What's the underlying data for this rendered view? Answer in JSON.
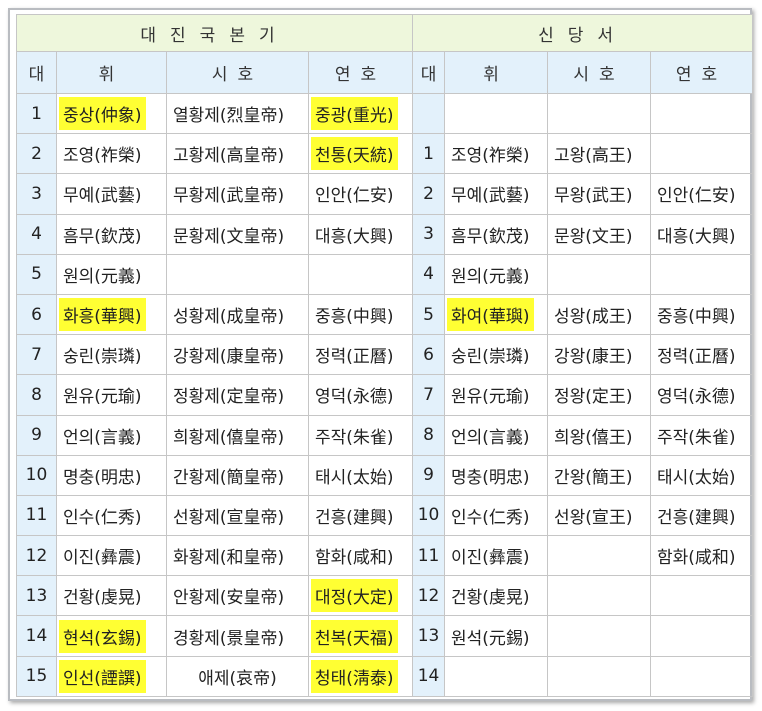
{
  "headers": {
    "left_group": "대진국본기",
    "right_group": "신당서",
    "num": "대",
    "hwi": "휘",
    "sho": "시호",
    "yeon": "연호"
  },
  "rows": [
    {
      "n": "1",
      "hwi": "중상(仲象)",
      "hwi_hl": true,
      "sho": "열황제(烈皇帝)",
      "yeon": "중광(重光)",
      "yeon_hl": true,
      "rn": "",
      "rhwi": "",
      "rsho": "",
      "ryeon": ""
    },
    {
      "n": "2",
      "hwi": "조영(祚榮)",
      "hwi_hl": false,
      "sho": "고황제(高皇帝)",
      "yeon": "천통(天統)",
      "yeon_hl": true,
      "rn": "1",
      "rhwi": "조영(祚榮)",
      "rsho": "고왕(高王)",
      "ryeon": ""
    },
    {
      "n": "3",
      "hwi": "무예(武藝)",
      "hwi_hl": false,
      "sho": "무황제(武皇帝)",
      "yeon": "인안(仁安)",
      "yeon_hl": false,
      "rn": "2",
      "rhwi": "무예(武藝)",
      "rsho": "무왕(武王)",
      "ryeon": "인안(仁安)"
    },
    {
      "n": "4",
      "hwi": "흠무(欽茂)",
      "hwi_hl": false,
      "sho": "문황제(文皇帝)",
      "yeon": "대흥(大興)",
      "yeon_hl": false,
      "rn": "3",
      "rhwi": "흠무(欽茂)",
      "rsho": "문왕(文王)",
      "ryeon": "대흥(大興)"
    },
    {
      "n": "5",
      "hwi": "원의(元義)",
      "hwi_hl": false,
      "sho": "",
      "yeon": "",
      "yeon_hl": false,
      "rn": "4",
      "rhwi": "원의(元義)",
      "rsho": "",
      "ryeon": ""
    },
    {
      "n": "6",
      "hwi": "화흥(華興)",
      "hwi_hl": true,
      "sho": "성황제(成皇帝)",
      "yeon": "중흥(中興)",
      "yeon_hl": false,
      "rn": "5",
      "rhwi": "화여(華璵)",
      "rhwi_hl": true,
      "rsho": "성왕(成王)",
      "ryeon": "중흥(中興)"
    },
    {
      "n": "7",
      "hwi": "숭린(崇璘)",
      "hwi_hl": false,
      "sho": "강황제(康皇帝)",
      "yeon": "정력(正曆)",
      "yeon_hl": false,
      "rn": "6",
      "rhwi": "숭린(崇璘)",
      "rsho": "강왕(康王)",
      "ryeon": "정력(正曆)"
    },
    {
      "n": "8",
      "hwi": "원유(元瑜)",
      "hwi_hl": false,
      "sho": "정황제(定皇帝)",
      "yeon": "영덕(永德)",
      "yeon_hl": false,
      "rn": "7",
      "rhwi": "원유(元瑜)",
      "rsho": "정왕(定王)",
      "ryeon": "영덕(永德)"
    },
    {
      "n": "9",
      "hwi": "언의(言義)",
      "hwi_hl": false,
      "sho": "희황제(僖皇帝)",
      "yeon": "주작(朱雀)",
      "yeon_hl": false,
      "rn": "8",
      "rhwi": "언의(言義)",
      "rsho": "희왕(僖王)",
      "ryeon": "주작(朱雀)"
    },
    {
      "n": "10",
      "hwi": "명충(明忠)",
      "hwi_hl": false,
      "sho": "간황제(簡皇帝)",
      "yeon": "태시(太始)",
      "yeon_hl": false,
      "rn": "9",
      "rhwi": "명충(明忠)",
      "rsho": "간왕(簡王)",
      "ryeon": "태시(太始)"
    },
    {
      "n": "11",
      "hwi": "인수(仁秀)",
      "hwi_hl": false,
      "sho": "선황제(宣皇帝)",
      "yeon": "건흥(建興)",
      "yeon_hl": false,
      "rn": "10",
      "rhwi": "인수(仁秀)",
      "rsho": "선왕(宣王)",
      "ryeon": "건흥(建興)"
    },
    {
      "n": "12",
      "hwi": "이진(彝震)",
      "hwi_hl": false,
      "sho": "화황제(和皇帝)",
      "yeon": "함화(咸和)",
      "yeon_hl": false,
      "rn": "11",
      "rhwi": "이진(彝震)",
      "rsho": "",
      "ryeon": "함화(咸和)"
    },
    {
      "n": "13",
      "hwi": "건황(虔晃)",
      "hwi_hl": false,
      "sho": "안황제(安皇帝)",
      "yeon": "대정(大定)",
      "yeon_hl": true,
      "rn": "12",
      "rhwi": "건황(虔晃)",
      "rsho": "",
      "ryeon": ""
    },
    {
      "n": "14",
      "hwi": "현석(玄錫)",
      "hwi_hl": true,
      "sho": "경황제(景皇帝)",
      "yeon": "천복(天福)",
      "yeon_hl": true,
      "rn": "13",
      "rhwi": "원석(元錫)",
      "rsho": "",
      "ryeon": ""
    },
    {
      "n": "15",
      "hwi": "인선(諲譔)",
      "hwi_hl": true,
      "sho": "애제(哀帝)",
      "sho_center": true,
      "yeon": "청태(淸泰)",
      "yeon_hl": true,
      "rn": "14",
      "rhwi": "",
      "rsho": "",
      "ryeon": ""
    }
  ]
}
